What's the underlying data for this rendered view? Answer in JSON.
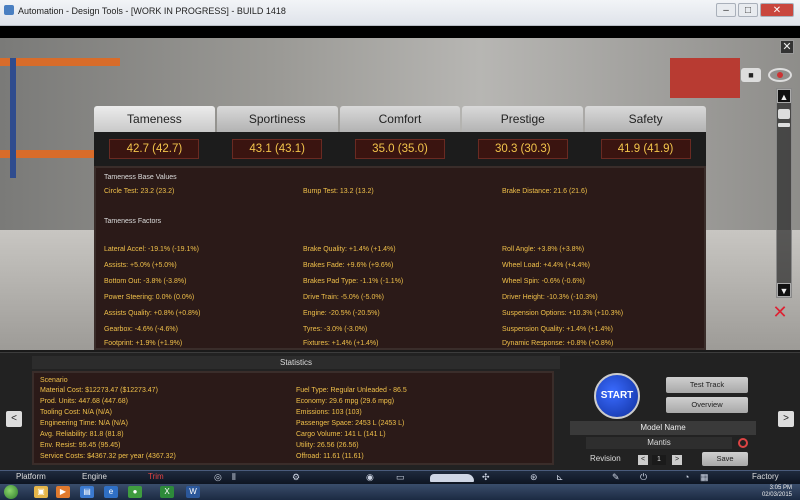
{
  "window": {
    "title": "Automation - Design Tools - [WORK IN PROGRESS] - BUILD 1418",
    "minimize": "–",
    "maximize": "□",
    "close": "✕"
  },
  "overlay_close": "✕",
  "tabs": [
    {
      "label": "Tameness",
      "score": "42.7 (42.7)"
    },
    {
      "label": "Sportiness",
      "score": "43.1 (43.1)"
    },
    {
      "label": "Comfort",
      "score": "35.0 (35.0)"
    },
    {
      "label": "Prestige",
      "score": "30.3 (30.3)"
    },
    {
      "label": "Safety",
      "score": "41.9 (41.9)"
    }
  ],
  "details": {
    "base_heading": "Tameness Base Values",
    "base_values": {
      "circle_test": {
        "label": "Circle Test:",
        "value": "23.2 (23.2)"
      },
      "bump_test": {
        "label": "Bump Test:",
        "value": "13.2 (13.2)"
      },
      "brake_distance": {
        "label": "Brake Distance:",
        "value": "21.6 (21.6)"
      }
    },
    "factors_heading": "Tameness Factors",
    "factors": [
      [
        "Lateral Accel: -19.1% (-19.1%)",
        "Brake Quality: +1.4% (+1.4%)",
        "Roll Angle: +3.8% (+3.8%)"
      ],
      [
        "Assists: +5.0% (+5.0%)",
        "Brakes Fade: +9.6% (+9.6%)",
        "Wheel Load: +4.4% (+4.4%)"
      ],
      [
        "Bottom Out: -3.8% (-3.8%)",
        "Brakes Pad Type: -1.1% (-1.1%)",
        "Wheel Spin: -0.6% (-0.6%)"
      ],
      [
        "Power Steering: 0.0% (0.0%)",
        "Drive Train: -5.0% (-5.0%)",
        "Driver Height: -10.3% (-10.3%)"
      ],
      [
        "Assists Quality: +0.8% (+0.8%)",
        "Engine: -20.5% (-20.5%)",
        "Suspension Options: +10.3% (+10.3%)"
      ],
      [
        "Gearbox: -4.6% (-4.6%)",
        "Tyres: -3.0% (-3.0%)",
        "Suspension Quality: +1.4% (+1.4%)"
      ],
      [
        "Footprint: +1.9% (+1.9%)",
        "Fixtures: +1.4% (+1.4%)",
        "Dynamic Response: +0.8% (+0.8%)"
      ]
    ]
  },
  "statistics": {
    "header": "Statistics",
    "scenario_label": "Scenario",
    "left": [
      "Material Cost: $12273.47 ($12273.47)",
      "Prod. Units: 447.68 (447.68)",
      "Tooling Cost: N/A (N/A)",
      "Engineering Time: N/A (N/A)",
      "Avg. Reliability: 81.8 (81.8)",
      "Env. Resist: 95.45 (95.45)",
      "Service Costs: $4367.32 per year (4367.32)"
    ],
    "right": [
      "Fuel Type: Regular Unleaded - 86.5",
      "Economy: 29.6 mpg (29.6 mpg)",
      "Emissions: 103 (103)",
      "Passenger Space: 2453 L (2453 L)",
      "Cargo Volume: 141 L (141 L)",
      "Utility: 26.56 (26.56)",
      "Offroad: 11.61 (11.61)"
    ]
  },
  "controls": {
    "prev": "<",
    "next": ">",
    "start": "START",
    "test_track": "Test Track",
    "overview": "Overview",
    "model_name_label": "Model Name",
    "model_name": "Mantis",
    "revision_label": "Revision",
    "revision_value": "1",
    "revision_prev": "<",
    "revision_next": ">",
    "save": "Save"
  },
  "nav": {
    "platform": "Platform",
    "engine": "Engine",
    "trim": "Trim",
    "factory": "Factory"
  },
  "taskbar": {
    "clock_time": "3:05 PM",
    "clock_date": "02/03/2015"
  },
  "accent": {
    "score_text": "#f0c04a",
    "active_nav": "#e14242",
    "start_button": "#2b55e0"
  }
}
